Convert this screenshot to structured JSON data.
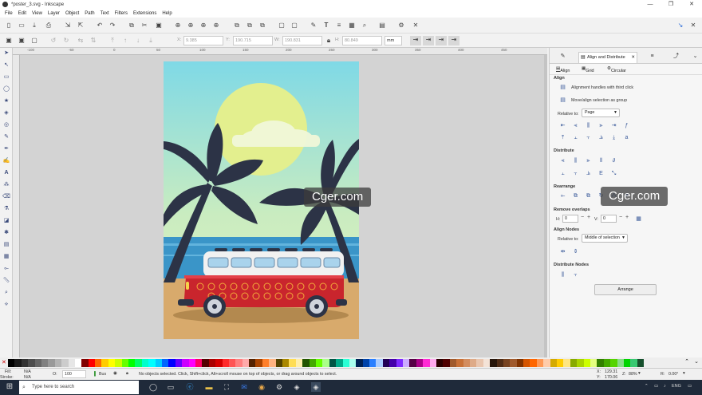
{
  "window": {
    "title": "*poster_3.svg - Inkscape",
    "controls": [
      "—",
      "❐",
      "✕"
    ]
  },
  "menu": [
    "File",
    "Edit",
    "View",
    "Layer",
    "Object",
    "Path",
    "Text",
    "Filters",
    "Extensions",
    "Help"
  ],
  "tool_controls": {
    "x_label": "X:",
    "x_value": "9.385",
    "y_label": "Y:",
    "y_value": "190.715",
    "w_label": "W:",
    "w_value": "190.831",
    "h_label": "H:",
    "h_value": "80.849",
    "unit": "mm"
  },
  "ruler_ticks": [
    "-100",
    "-50",
    "0",
    "50",
    "100",
    "150",
    "200",
    "250",
    "300",
    "350",
    "400",
    "450"
  ],
  "panel": {
    "tab_title": "Align and Distribute",
    "subtabs": [
      "Align",
      "Grid",
      "Circular"
    ],
    "align_header": "Align",
    "opt1": "Alignment handles with third click",
    "opt2": "Move/align selection as group",
    "relative_label": "Relative to:",
    "relative_value": "Page",
    "distribute_header": "Distribute",
    "rearrange_header": "Rearrange",
    "remove_overlaps_header": "Remove overlaps",
    "h_label": "H:",
    "h_value": "0",
    "v_label": "V:",
    "v_value": "0",
    "align_nodes_header": "Align Nodes",
    "nodes_relative_label": "Relative to:",
    "nodes_relative_value": "Middle of selection",
    "distribute_nodes_header": "Distribute Nodes",
    "arrange_button": "Arrange"
  },
  "palette": [
    "#000000",
    "#1a1a1a",
    "#333333",
    "#4d4d4d",
    "#666666",
    "#808080",
    "#999999",
    "#b3b3b3",
    "#cccccc",
    "#e6e6e6",
    "#ffffff",
    "#800000",
    "#ff0000",
    "#ff6600",
    "#ffcc00",
    "#ffff00",
    "#ccff00",
    "#66ff00",
    "#00ff00",
    "#00ff66",
    "#00ffcc",
    "#00ffff",
    "#00ccff",
    "#0066ff",
    "#0000ff",
    "#6600ff",
    "#cc00ff",
    "#ff00ff",
    "#ff0066",
    "#550000",
    "#aa0000",
    "#d40000",
    "#ff2a2a",
    "#ff5555",
    "#ff8080",
    "#ffaaaa",
    "#552200",
    "#aa4400",
    "#ff7f2a",
    "#ffb380",
    "#554400",
    "#aa8800",
    "#ffdd55",
    "#ffeeaa",
    "#225500",
    "#44aa00",
    "#66ff00",
    "#aaff88",
    "#005544",
    "#00aa88",
    "#2affd5",
    "#aaffee",
    "#002255",
    "#0044aa",
    "#2a7fff",
    "#aaccff",
    "#220055",
    "#4400aa",
    "#7f2aff",
    "#ccaaff",
    "#550044",
    "#aa0088",
    "#ff2ad4",
    "#ffaaee",
    "#2b0000",
    "#500000",
    "#a05a2c",
    "#c87137",
    "#d38d5f",
    "#deaa87",
    "#e9c6af",
    "#f4e3d7",
    "#28170b",
    "#502d16",
    "#784421",
    "#a05a2c",
    "#803300",
    "#d45500",
    "#ff6600",
    "#ff9955",
    "#ffccaa",
    "#d4aa00",
    "#ffcc00",
    "#ffe680",
    "#88aa00",
    "#aad400",
    "#ccff00",
    "#e5ff80",
    "#338000",
    "#44aa00",
    "#55d400",
    "#87de87",
    "#00d400",
    "#37c871",
    "#16502d"
  ],
  "status": {
    "fill_label": "Fill:",
    "fill_value": "N/A",
    "stroke_label": "Stroke:",
    "stroke_value": "N/A",
    "opacity_label": "O:",
    "opacity_value": "100",
    "layer": "Bus",
    "message": "No objects selected. Click, Shift+click, Alt+scroll mouse on top of objects, or drag around objects to select.",
    "x_label": "X:",
    "x_value": "129.31",
    "y_label": "Y:",
    "y_value": "170.06",
    "z_label": "Z:",
    "z_value": "88%",
    "r_label": "R:",
    "r_value": "0.00°"
  },
  "taskbar": {
    "search_placeholder": "Type here to search",
    "lang": "ENG"
  },
  "watermarks": [
    "Cger.com",
    "Cger.com"
  ]
}
